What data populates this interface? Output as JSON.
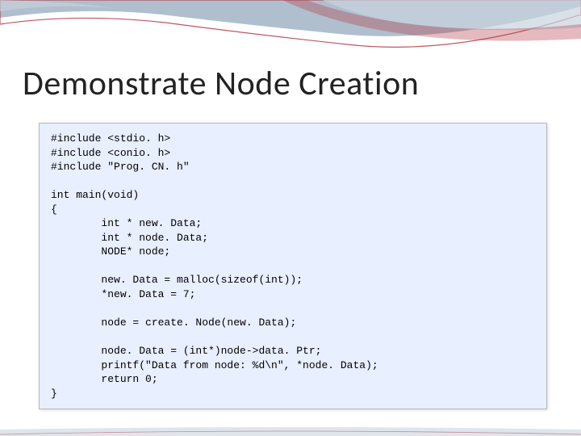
{
  "slide": {
    "title": "Demonstrate Node Creation"
  },
  "code": {
    "lines": [
      "#include <stdio. h>",
      "#include <conio. h>",
      "#include \"Prog. CN. h\"",
      "",
      "int main(void)",
      "{",
      "        int * new. Data;",
      "        int * node. Data;",
      "        NODE* node;",
      "",
      "        new. Data = malloc(sizeof(int));",
      "        *new. Data = 7;",
      "",
      "        node = create. Node(new. Data);",
      "",
      "        node. Data = (int*)node->data. Ptr;",
      "        printf(\"Data from node: %d\\n\", *node. Data);",
      "        return 0;",
      "}"
    ]
  }
}
